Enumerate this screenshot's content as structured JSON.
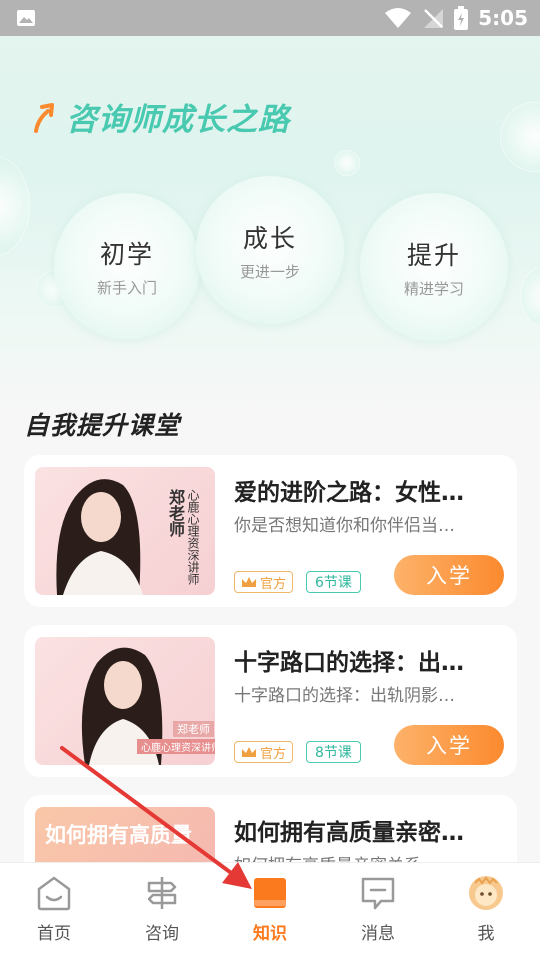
{
  "status_bar": {
    "time": "5:05"
  },
  "hero": {
    "title": "咨询师成长之路"
  },
  "levels": [
    {
      "main": "初学",
      "sub": "新手入门"
    },
    {
      "main": "成长",
      "sub": "更进一步"
    },
    {
      "main": "提升",
      "sub": "精进学习"
    }
  ],
  "section": {
    "title": "自我提升课堂"
  },
  "courses": [
    {
      "title": "爱的进阶之路：女性…",
      "desc": "你是否想知道你和你伴侣当…",
      "official": "官方",
      "lessons": "6节课",
      "enroll": "入学",
      "thumb_name": "郑老师",
      "thumb_role": "心鹿心理资深讲师"
    },
    {
      "title": "十字路口的选择：出…",
      "desc": "十字路口的选择：出轨阴影…",
      "official": "官方",
      "lessons": "8节课",
      "enroll": "入学",
      "thumb_name": "郑老师",
      "thumb_role": "心鹿心理资深讲师"
    },
    {
      "title": "如何拥有高质量亲密…",
      "desc": "如何拥有高质量亲密关系",
      "thumb_overlay": "如何拥有高质量"
    }
  ],
  "tabbar": [
    {
      "label": "首页",
      "icon": "home-icon"
    },
    {
      "label": "咨询",
      "icon": "signpost-icon"
    },
    {
      "label": "知识",
      "icon": "book-icon",
      "active": true
    },
    {
      "label": "消息",
      "icon": "message-icon"
    },
    {
      "label": "我",
      "icon": "avatar-icon"
    }
  ],
  "colors": {
    "accent": "#fb7a1e",
    "teal": "#48c9b0",
    "annotation": "#e53935"
  }
}
